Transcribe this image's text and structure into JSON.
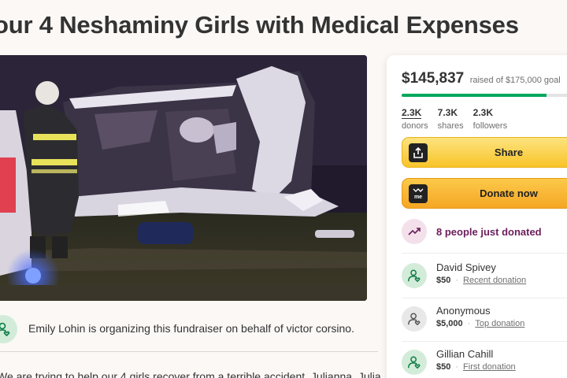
{
  "campaign": {
    "title": "our 4 Neshaminy Girls with Medical Expenses",
    "organizer_text": "Emily Lohin is organizing this fundraiser on behalf of victor corsino.",
    "story_preview": "We are trying to help our 4 girls recover from a terrible accident. Julianna, Julia"
  },
  "donation_card": {
    "raised_amount": "$145,837",
    "raised_suffix": "raised of $175,000 goal",
    "progress_fraction": 0.833,
    "stats": [
      {
        "value": "2.3K",
        "label": "donors"
      },
      {
        "value": "7.3K",
        "label": "shares"
      },
      {
        "value": "2.3K",
        "label": "followers"
      }
    ],
    "share_label": "Share",
    "donate_label": "Donate now",
    "recent_activity": "8 people just donated",
    "donations": [
      {
        "name": "David Spivey",
        "amount": "$50",
        "kind": "Recent donation",
        "avatar": "green"
      },
      {
        "name": "Anonymous",
        "amount": "$5,000",
        "kind": "Top donation",
        "avatar": "grey"
      },
      {
        "name": "Gillian Cahill",
        "amount": "$50",
        "kind": "First donation",
        "avatar": "green"
      }
    ]
  },
  "colors": {
    "accent_green": "#02a95c",
    "button_yellow": "#f8c42a",
    "button_orange": "#f5a624",
    "activity_purple": "#6c1d5b"
  },
  "icons": {
    "share": "share-upload-icon",
    "donate": "donate-me-icon",
    "trend": "trending-up-icon",
    "person": "person-heart-icon"
  }
}
